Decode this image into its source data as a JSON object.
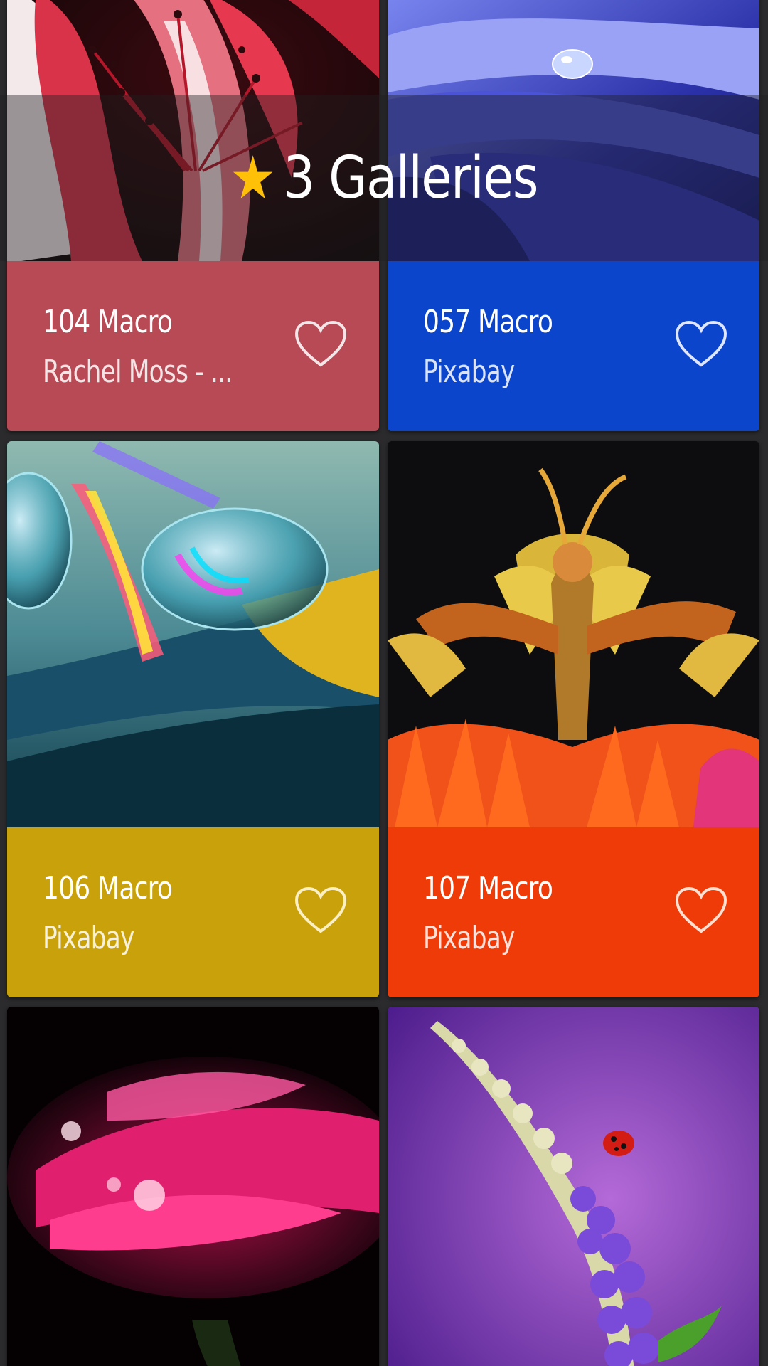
{
  "header": {
    "title": "3 Galleries",
    "star_icon": "star-icon",
    "star_color": "#ffc107"
  },
  "cards": [
    {
      "title": "104 Macro",
      "subtitle": "Rachel Moss - ...",
      "info_color": "#b84a55",
      "favorite_icon": "heart-outline-icon",
      "photo": "red-white lily closeup"
    },
    {
      "title": "057 Macro",
      "subtitle": "Pixabay",
      "info_color": "#0b45cc",
      "favorite_icon": "heart-outline-icon",
      "photo": "blue petals with water drop"
    },
    {
      "title": "106 Macro",
      "subtitle": "Pixabay",
      "info_color": "#c9a10a",
      "favorite_icon": "heart-outline-icon",
      "photo": "water droplets on CD rainbow"
    },
    {
      "title": "107 Macro",
      "subtitle": "Pixabay",
      "info_color": "#ee3b07",
      "favorite_icon": "heart-outline-icon",
      "photo": "orchid mantis on orange flower"
    },
    {
      "photo": "pink gerbera with droplets"
    },
    {
      "photo": "lupine flower with ladybug"
    }
  ]
}
